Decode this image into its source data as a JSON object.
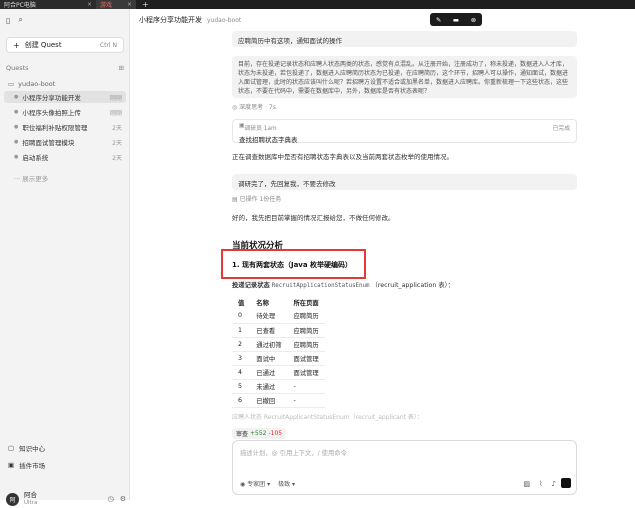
{
  "tabs": [
    {
      "label": "阿合PC电脑",
      "close": "×"
    },
    {
      "label": "游戏",
      "close": "×"
    }
  ],
  "tab_plus": "+",
  "sidebar": {
    "new_quest_label": "创建 Quest",
    "new_quest_shortcut": "Ctrl N",
    "quests_label": "Quests",
    "folder": "yudao-boot",
    "items": [
      {
        "label": "小程序分享功能开发",
        "time": "刚刚"
      },
      {
        "label": "小程序头像拍照上传",
        "time": "刚刚"
      },
      {
        "label": "职位福利补贴权限管理",
        "time": "2天"
      },
      {
        "label": "招聘面试管理模块",
        "time": "2天"
      },
      {
        "label": "启动系统",
        "time": "2天"
      },
      {
        "label": "展示更多",
        "time": ""
      }
    ],
    "knowledge": "知识中心",
    "plugins": "插件市场",
    "user_name": "阿合",
    "user_plan": "Ultra"
  },
  "header": {
    "title": "小程序分享功能开发",
    "repo": "yudao-boot"
  },
  "chat": {
    "top_bubble": "应聘简历中有这项，通知面试的操作",
    "question": "目前，存在投递记录状态和应聘人状态两类的状态，感觉有点混乱。从注册开始，注册成功了，称未投递，数据进入人才库，状态为未投递，若包投递了，数据进入应聘简历状态为已投递，在应聘简历，这个环节，招聘人可以操作，通知面试，数据进入面试管理，此时的状态应该叫什么呢？若招聘方设置不适合或加黑名单，数据进入应聘库。你重新梳理一下这些状态，这些状态，不要在代码中，需要在数据库中，另外，数据库是否有状态表呢？",
    "thinking": "深度思考 · 7s",
    "tool_title": "调研员 1am",
    "tool_status": "已完成",
    "tool_desc": "查找招聘状态字典表",
    "ai_line1": "正在调查数据库中是否有招聘状态字典表以及当前两套状态枚举的使用情况。",
    "user_msg": "调研完了，先回复我，不要去修改",
    "done_status": "已操作 1份任务",
    "ai_line2": "好的，我先把目前掌握的情况汇报给您，不做任何修改。",
    "section_title": "当前状况分析",
    "sub_title": "1. 现有两套状态（Java 枚举硬编码）",
    "enum_prefix": "投递记录状态",
    "enum_name": "RecruitApplicationStatusEnum",
    "enum_suffix": "（recruit_application 表）：",
    "table_headers": [
      "值",
      "名称",
      "所在页面"
    ],
    "table_rows": [
      [
        "0",
        "待处理",
        "应聘简历"
      ],
      [
        "1",
        "已查看",
        "应聘简历"
      ],
      [
        "2",
        "通过初筛",
        "应聘简历"
      ],
      [
        "3",
        "面试中",
        "面试管理"
      ],
      [
        "4",
        "已通过",
        "面试管理"
      ],
      [
        "5",
        "未通过",
        "-"
      ],
      [
        "6",
        "已撤回",
        "-"
      ]
    ],
    "faded_line": "应聘人状态 RecruitApplicantStatusEnum（recruit_applicant 表）：",
    "diff_label": "审查",
    "diff_add": "+552",
    "diff_del": "-105",
    "input_placeholder": "描述计划，@ 引用上下文，/ 使用命令",
    "mode_label": "专家团",
    "model_label": "极致"
  },
  "colors": {
    "highlight": "#e53935",
    "diff_add": "#2e7d32",
    "diff_del": "#d32f2f"
  }
}
